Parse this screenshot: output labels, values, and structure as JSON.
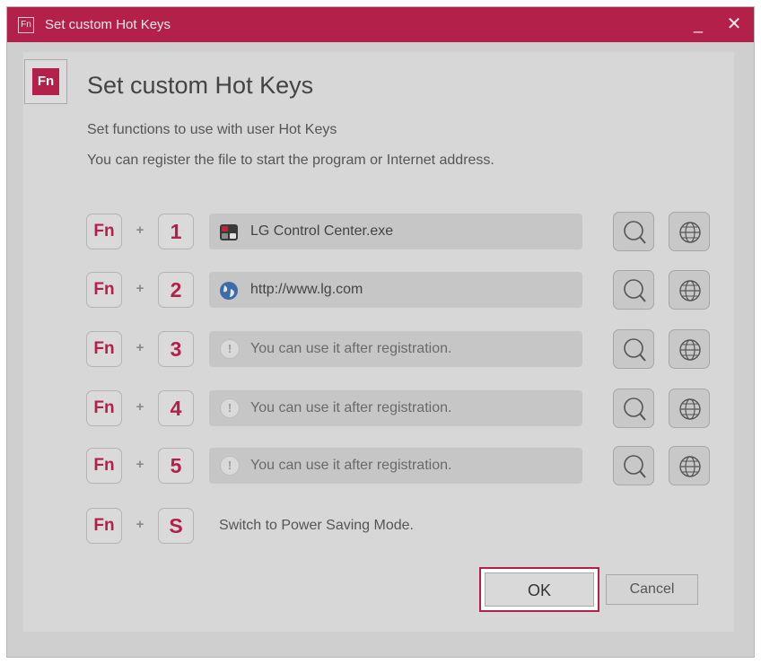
{
  "window": {
    "title": "Set custom Hot Keys",
    "app_icon_label": "Fn",
    "minimize_glyph": "_",
    "close_glyph": "✕"
  },
  "header": {
    "icon_label": "Fn",
    "title": "Set custom Hot Keys",
    "description_line1": "Set functions to use with user Hot Keys",
    "description_line2": "You can register the file to start the program or Internet address."
  },
  "hotkeys": [
    {
      "modifier": "Fn",
      "plus": "+",
      "key": "1",
      "type": "program",
      "icon": "lg-control-center-icon",
      "value": "LG Control Center.exe"
    },
    {
      "modifier": "Fn",
      "plus": "+",
      "key": "2",
      "type": "url",
      "icon": "globe-icon",
      "value": "http://www.lg.com"
    },
    {
      "modifier": "Fn",
      "plus": "+",
      "key": "3",
      "type": "empty",
      "icon": "warning-icon",
      "warning_glyph": "!",
      "value": "You can use it after registration."
    },
    {
      "modifier": "Fn",
      "plus": "+",
      "key": "4",
      "type": "empty",
      "icon": "warning-icon",
      "warning_glyph": "!",
      "value": "You can use it after registration."
    },
    {
      "modifier": "Fn",
      "plus": "+",
      "key": "5",
      "type": "empty",
      "icon": "warning-icon",
      "warning_glyph": "!",
      "value": "You can use it after registration."
    }
  ],
  "power_saving": {
    "modifier": "Fn",
    "plus": "+",
    "key": "S",
    "label": "Switch to Power Saving Mode."
  },
  "buttons": {
    "ok": "OK",
    "cancel": "Cancel"
  },
  "colors": {
    "accent": "#b3204a",
    "background": "#d7d7d7"
  }
}
